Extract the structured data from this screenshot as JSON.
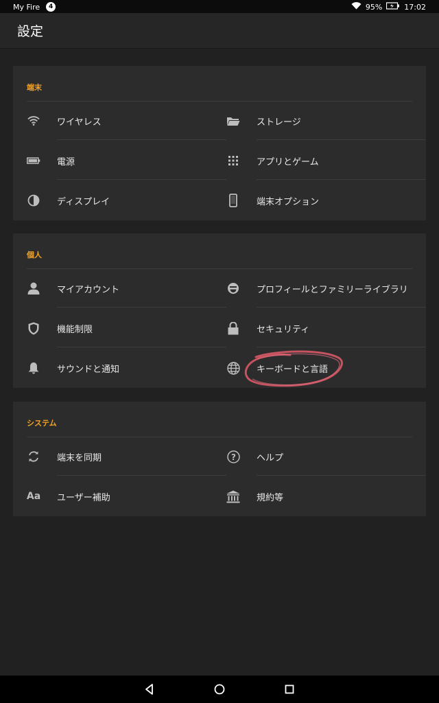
{
  "status_bar": {
    "device_name": "My Fire",
    "notification_count": "4",
    "battery": "95%",
    "time": "17:02"
  },
  "header": {
    "title": "設定"
  },
  "sections": [
    {
      "title": "端末",
      "items": [
        {
          "label": "ワイヤレス",
          "icon": "wifi-icon"
        },
        {
          "label": "ストレージ",
          "icon": "folder-icon"
        },
        {
          "label": "電源",
          "icon": "battery-icon"
        },
        {
          "label": "アプリとゲーム",
          "icon": "grid-icon"
        },
        {
          "label": "ディスプレイ",
          "icon": "contrast-icon"
        },
        {
          "label": "端末オプション",
          "icon": "phone-icon"
        }
      ]
    },
    {
      "title": "個人",
      "items": [
        {
          "label": "マイアカウント",
          "icon": "person-icon"
        },
        {
          "label": "プロフィールとファミリーライブラリ",
          "icon": "smiley-icon"
        },
        {
          "label": "機能制限",
          "icon": "shield-icon"
        },
        {
          "label": "セキュリティ",
          "icon": "lock-icon"
        },
        {
          "label": "サウンドと通知",
          "icon": "bell-icon"
        },
        {
          "label": "キーボードと言語",
          "icon": "globe-icon"
        }
      ]
    },
    {
      "title": "システム",
      "items": [
        {
          "label": "端末を同期",
          "icon": "sync-icon"
        },
        {
          "label": "ヘルプ",
          "icon": "help-icon"
        },
        {
          "label": "ユーザー補助",
          "icon": "text-size-icon"
        },
        {
          "label": "規約等",
          "icon": "institution-icon"
        }
      ]
    }
  ],
  "accessibility_icon_text": "Aa",
  "annotation": {
    "icon": "hand-drawn-circle",
    "color": "#e05a6a"
  },
  "colors": {
    "accent": "#f2a225",
    "card": "#2c2c2c",
    "background": "#212121"
  },
  "nav_bar": {
    "back_icon": "back-triangle-icon",
    "home_icon": "home-circle-icon",
    "recents_icon": "recents-square-icon"
  }
}
